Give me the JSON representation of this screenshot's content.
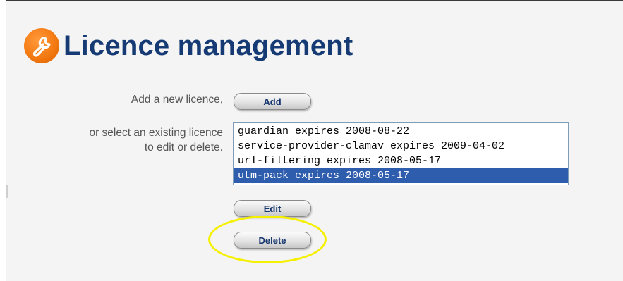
{
  "page": {
    "title": "Licence management",
    "icon": "wrench-icon",
    "accent_color": "#f47a12",
    "title_color": "#163a74"
  },
  "add_section": {
    "label": "Add a new licence,",
    "button_label": "Add"
  },
  "select_section": {
    "label_line1": "or select an existing licence",
    "label_line2": "to edit or delete."
  },
  "licences": [
    {
      "text": "guardian expires 2008-08-22",
      "selected": false
    },
    {
      "text": "service-provider-clamav expires 2009-04-02",
      "selected": false
    },
    {
      "text": "url-filtering expires 2008-05-17",
      "selected": false
    },
    {
      "text": "utm-pack expires 2008-05-17",
      "selected": true
    }
  ],
  "actions": {
    "edit_label": "Edit",
    "delete_label": "Delete"
  },
  "annotation": {
    "highlight_color": "#f5f000",
    "highlighted": "delete-button"
  }
}
